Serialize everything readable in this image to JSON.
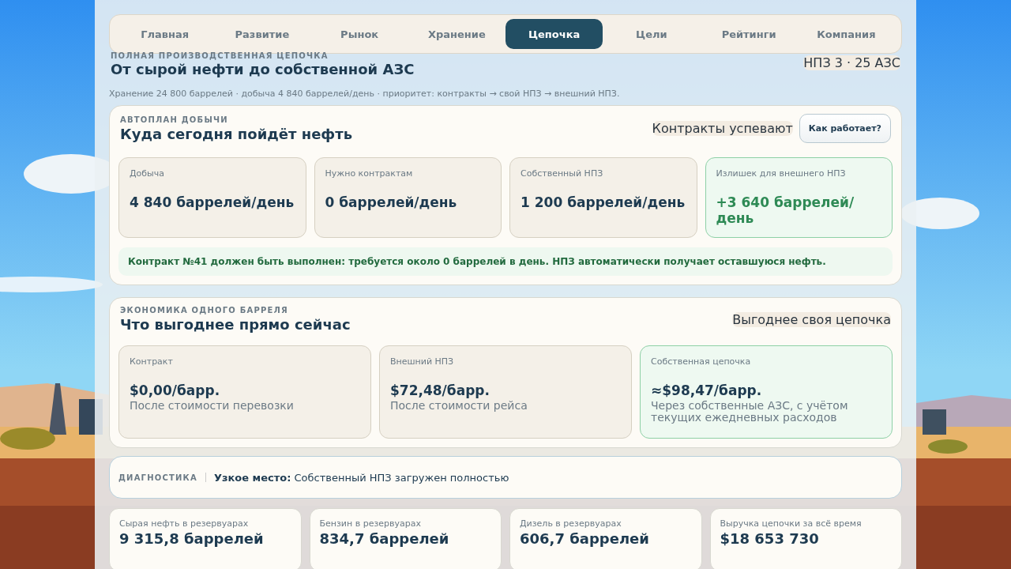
{
  "nav": [
    {
      "label": "Главная",
      "selected": false
    },
    {
      "label": "Развитие",
      "selected": false
    },
    {
      "label": "Рынок",
      "selected": false
    },
    {
      "label": "Хранение",
      "selected": false
    },
    {
      "label": "Цепочка",
      "selected": true
    },
    {
      "label": "Цели",
      "selected": false
    },
    {
      "label": "Рейтинги",
      "selected": false
    },
    {
      "label": "Компания",
      "selected": false
    }
  ],
  "header": {
    "eyebrow": "ПОЛНАЯ ПРОИЗВОДСТВЕННАЯ ЦЕПОЧКА",
    "title": "От сырой нефти до собственной АЗС",
    "badge": "НПЗ 3 · 25 АЗС",
    "subtitle": "Хранение 24 800 баррелей · добыча 4 840 баррелей/день · приоритет: контракты → свой НПЗ → внешний НПЗ."
  },
  "plan": {
    "eyebrow": "АВТОПЛАН ДОБЫЧИ",
    "title": "Куда сегодня пойдёт нефть",
    "badge": "Контракты успевают",
    "button": "Как работает?",
    "tiles": [
      {
        "label": "Добыча",
        "value": "4 840 баррелей/день",
        "highlight": false
      },
      {
        "label": "Нужно контрактам",
        "value": "0 баррелей/день",
        "highlight": false
      },
      {
        "label": "Собственный НПЗ",
        "value": "1 200 баррелей/день",
        "highlight": false
      },
      {
        "label": "Излишек для внешнего НПЗ",
        "value": "+3 640 баррелей/день",
        "highlight": true
      }
    ],
    "note": "Контракт №41 должен быть выполнен: требуется около 0 баррелей в день. НПЗ автоматически получает оставшуюся нефть."
  },
  "economy": {
    "eyebrow": "ЭКОНОМИКА ОДНОГО БАРРЕЛЯ",
    "title": "Что выгоднее прямо сейчас",
    "badge": "Выгоднее своя цепочка",
    "tiles": [
      {
        "label": "Контракт",
        "value": "$0,00/барр.",
        "detail": "После стоимости перевозки",
        "highlight": false
      },
      {
        "label": "Внешний НПЗ",
        "value": "$72,48/барр.",
        "detail": "После стоимости рейса",
        "highlight": false
      },
      {
        "label": "Собственная цепочка",
        "value": "≈$98,47/барр.",
        "detail": "Через собственные АЗС, с учётом текущих ежедневных расходов",
        "highlight": true
      }
    ]
  },
  "diagnostics": {
    "label": "ДИАГНОСТИКА",
    "text": "**Узкое место:** Собственный НПЗ загружен полностью"
  },
  "stats": [
    {
      "label": "Сырая нефть в резервуарах",
      "value": "9 315,8 баррелей"
    },
    {
      "label": "Бензин в резервуарах",
      "value": "834,7 баррелей"
    },
    {
      "label": "Дизель в резервуарах",
      "value": "606,7 баррелей"
    },
    {
      "label": "Выручка цепочки за всё время",
      "value": "$18 653 730"
    }
  ]
}
